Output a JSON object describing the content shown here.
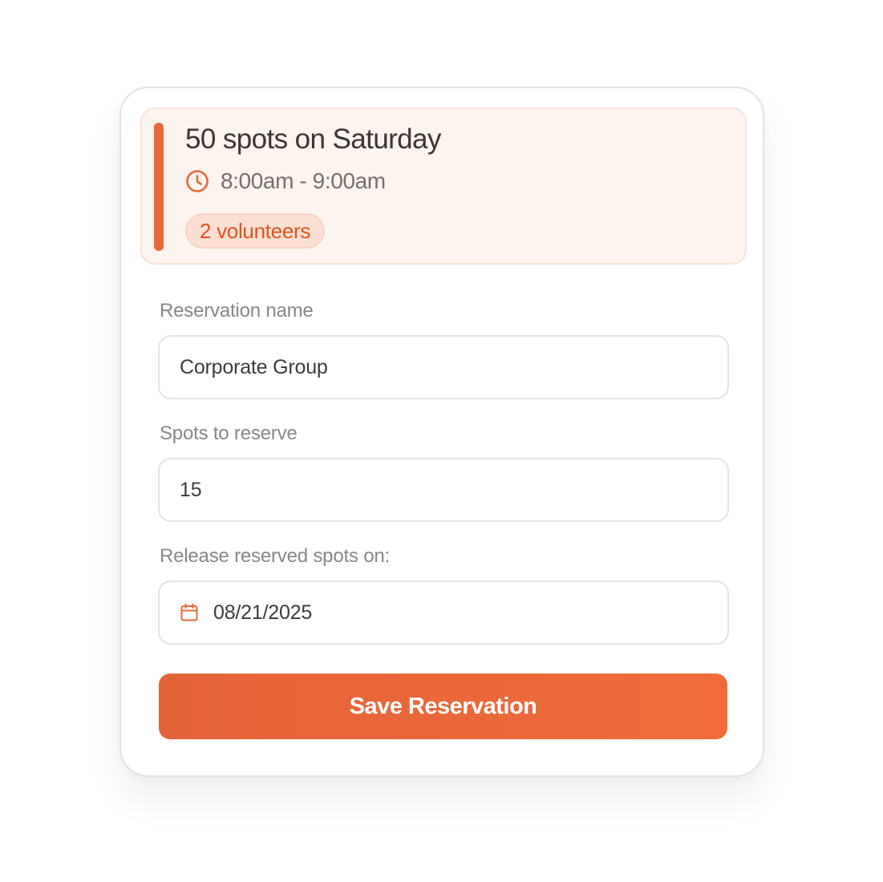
{
  "slot": {
    "title": "50 spots on Saturday",
    "time": "8:00am - 9:00am",
    "time_icon": "clock-icon",
    "badge": "2 volunteers"
  },
  "form": {
    "reservation_name": {
      "label": "Reservation name",
      "value": "Corporate Group"
    },
    "spots": {
      "label": "Spots to reserve",
      "value": "15"
    },
    "release_date": {
      "label": "Release reserved spots on:",
      "value": "08/21/2025",
      "icon": "calendar-icon"
    },
    "save_label": "Save Reservation"
  },
  "colors": {
    "accent": "#e9683a",
    "badge_text": "#e0531f",
    "slot_background": "#fdf3ef"
  }
}
